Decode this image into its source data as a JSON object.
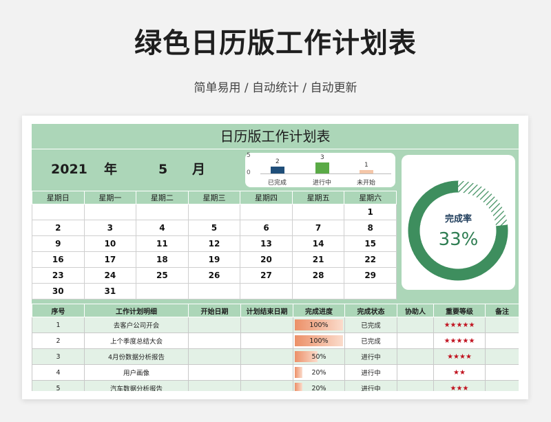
{
  "hero": {
    "title": "绿色日历版工作计划表",
    "subtitle": "简单易用 / 自动统计 / 自动更新"
  },
  "sheet": {
    "title": "日历版工作计划表",
    "year": "2021",
    "year_unit": "年",
    "month": "5",
    "month_unit": "月"
  },
  "colors": {
    "header_green": "#acd6b8",
    "donut_green": "#3e8e5e",
    "bar_blue": "#1f4e79",
    "bar_green": "#5aaa46",
    "bar_peach": "#f4c6a8",
    "star_red": "#c0121f",
    "progress_orange": "#ec9068"
  },
  "chart_data": [
    {
      "type": "bar",
      "categories": [
        "已完成",
        "进行中",
        "未开始"
      ],
      "values": [
        2,
        3,
        1
      ],
      "ylim": [
        0,
        5
      ],
      "yticks": [
        "5",
        "0"
      ],
      "grid": false
    },
    {
      "type": "pie",
      "style": "donut",
      "title": "完成率",
      "value_label": "33%",
      "values": [
        0.33,
        0.67
      ]
    }
  ],
  "calendar": {
    "weekdays": [
      "星期日",
      "星期一",
      "星期二",
      "星期三",
      "星期四",
      "星期五",
      "星期六"
    ],
    "weeks": [
      [
        "",
        "",
        "",
        "",
        "",
        "",
        "1"
      ],
      [
        "2",
        "3",
        "4",
        "5",
        "6",
        "7",
        "8"
      ],
      [
        "9",
        "10",
        "11",
        "12",
        "13",
        "14",
        "15"
      ],
      [
        "16",
        "17",
        "18",
        "19",
        "20",
        "21",
        "22"
      ],
      [
        "23",
        "24",
        "25",
        "26",
        "27",
        "28",
        "29"
      ],
      [
        "30",
        "31",
        "",
        "",
        "",
        "",
        ""
      ]
    ]
  },
  "tasks": {
    "headers": [
      "序号",
      "工作计划明细",
      "开始日期",
      "计划结束日期",
      "完成进度",
      "完成状态",
      "协助人",
      "重要等级",
      "备注"
    ],
    "rows": [
      {
        "no": "1",
        "detail": "去客户公司开会",
        "start": "",
        "end": "",
        "progress": "100%",
        "progress_value": 1.0,
        "status": "已完成",
        "helper": "",
        "stars": "★★★★★",
        "note": ""
      },
      {
        "no": "2",
        "detail": "上个季度总结大会",
        "start": "",
        "end": "",
        "progress": "100%",
        "progress_value": 1.0,
        "status": "已完成",
        "helper": "",
        "stars": "★★★★★",
        "note": ""
      },
      {
        "no": "3",
        "detail": "4月份数据分析报告",
        "start": "",
        "end": "",
        "progress": "50%",
        "progress_value": 0.5,
        "status": "进行中",
        "helper": "",
        "stars": "★★★★",
        "note": ""
      },
      {
        "no": "4",
        "detail": "用户画像",
        "start": "",
        "end": "",
        "progress": "20%",
        "progress_value": 0.2,
        "status": "进行中",
        "helper": "",
        "stars": "★★",
        "note": ""
      },
      {
        "no": "5",
        "detail": "汽车数据分析报告",
        "start": "",
        "end": "",
        "progress": "20%",
        "progress_value": 0.2,
        "status": "进行中",
        "helper": "",
        "stars": "★★★",
        "note": ""
      }
    ]
  }
}
